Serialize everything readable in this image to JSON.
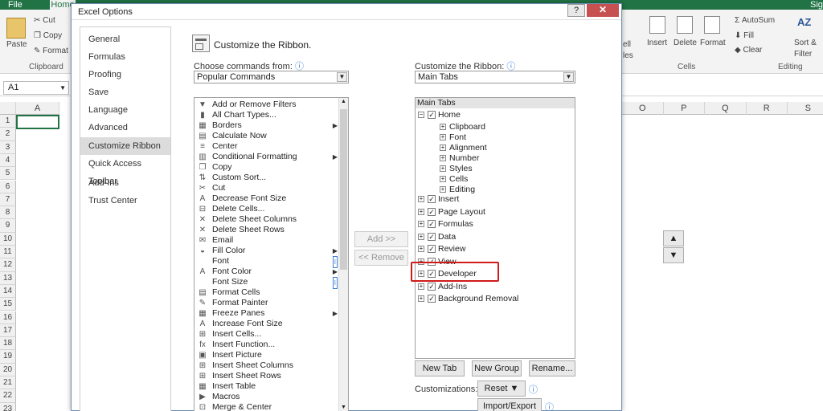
{
  "excel": {
    "tabs": {
      "file": "File",
      "home": "Home",
      "sign": "Sig"
    },
    "clipboard": {
      "paste": "Paste",
      "cut": "Cut",
      "copy": "Copy",
      "format": "Format",
      "group": "Clipboard"
    },
    "cells": {
      "insert": "Insert",
      "delete": "Delete",
      "format": "Format",
      "group": "Cells",
      "cell_partial": "ell",
      "les_partial": "les"
    },
    "editing": {
      "autosum": "AutoSum",
      "fill": "Fill",
      "clear": "Clear",
      "sort": "Sort &",
      "filter": "Filter",
      "group": "Editing"
    },
    "name_box": "A1",
    "columns_left": [
      "A"
    ],
    "columns_right": [
      "O",
      "P",
      "Q",
      "R",
      "S"
    ],
    "rows": [
      "1",
      "2",
      "3",
      "4",
      "5",
      "6",
      "7",
      "8",
      "9",
      "10",
      "11",
      "12",
      "13",
      "14",
      "15",
      "16",
      "17",
      "18",
      "19",
      "20",
      "21",
      "22",
      "23"
    ]
  },
  "dialog": {
    "title": "Excel Options",
    "help": "?",
    "close": "✕",
    "nav": [
      "General",
      "Formulas",
      "Proofing",
      "Save",
      "Language",
      "Advanced",
      "Customize Ribbon",
      "Quick Access Toolbar",
      "Add-Ins",
      "Trust Center"
    ],
    "selected_nav": "Customize Ribbon",
    "heading": "Customize the Ribbon.",
    "choose_label": "Choose commands from:",
    "choose_value": "Popular Commands",
    "customize_label": "Customize the Ribbon:",
    "customize_value": "Main Tabs",
    "commands": [
      {
        "icon": "filter-icon",
        "glyph": "▼",
        "label": "Add or Remove Filters",
        "arrow": ""
      },
      {
        "icon": "chart-icon",
        "glyph": "▮",
        "label": "All Chart Types...",
        "arrow": ""
      },
      {
        "icon": "borders-icon",
        "glyph": "▦",
        "label": "Borders",
        "arrow": "▶"
      },
      {
        "icon": "calculator-icon",
        "glyph": "▤",
        "label": "Calculate Now",
        "arrow": ""
      },
      {
        "icon": "center-icon",
        "glyph": "≡",
        "label": "Center",
        "arrow": ""
      },
      {
        "icon": "conditional-format-icon",
        "glyph": "▥",
        "label": "Conditional Formatting",
        "arrow": "▶"
      },
      {
        "icon": "copy-icon",
        "glyph": "❐",
        "label": "Copy",
        "arrow": ""
      },
      {
        "icon": "sort-icon",
        "glyph": "⇅",
        "label": "Custom Sort...",
        "arrow": ""
      },
      {
        "icon": "scissors-icon",
        "glyph": "✂",
        "label": "Cut",
        "arrow": ""
      },
      {
        "icon": "font-decrease-icon",
        "glyph": "A",
        "label": "Decrease Font Size",
        "arrow": ""
      },
      {
        "icon": "delete-cells-icon",
        "glyph": "⊟",
        "label": "Delete Cells...",
        "arrow": ""
      },
      {
        "icon": "delete-columns-icon",
        "glyph": "✕",
        "label": "Delete Sheet Columns",
        "arrow": ""
      },
      {
        "icon": "delete-rows-icon",
        "glyph": "✕",
        "label": "Delete Sheet Rows",
        "arrow": ""
      },
      {
        "icon": "email-icon",
        "glyph": "✉",
        "label": "Email",
        "arrow": ""
      },
      {
        "icon": "fill-color-icon",
        "glyph": "◒",
        "label": "Fill Color",
        "arrow": "▶"
      },
      {
        "icon": "font-icon",
        "glyph": "",
        "label": "Font",
        "arrow": "I"
      },
      {
        "icon": "font-color-icon",
        "glyph": "A",
        "label": "Font Color",
        "arrow": "▶"
      },
      {
        "icon": "font-size-icon",
        "glyph": "",
        "label": "Font Size",
        "arrow": "I"
      },
      {
        "icon": "format-cells-icon",
        "glyph": "▤",
        "label": "Format Cells",
        "arrow": ""
      },
      {
        "icon": "format-painter-icon",
        "glyph": "✎",
        "label": "Format Painter",
        "arrow": ""
      },
      {
        "icon": "freeze-panes-icon",
        "glyph": "▦",
        "label": "Freeze Panes",
        "arrow": "▶"
      },
      {
        "icon": "font-increase-icon",
        "glyph": "A",
        "label": "Increase Font Size",
        "arrow": ""
      },
      {
        "icon": "insert-cells-icon",
        "glyph": "⊞",
        "label": "Insert Cells...",
        "arrow": ""
      },
      {
        "icon": "function-icon",
        "glyph": "fx",
        "label": "Insert Function...",
        "arrow": ""
      },
      {
        "icon": "picture-icon",
        "glyph": "▣",
        "label": "Insert Picture",
        "arrow": ""
      },
      {
        "icon": "insert-columns-icon",
        "glyph": "⊞",
        "label": "Insert Sheet Columns",
        "arrow": ""
      },
      {
        "icon": "insert-rows-icon",
        "glyph": "⊞",
        "label": "Insert Sheet Rows",
        "arrow": ""
      },
      {
        "icon": "table-icon",
        "glyph": "▦",
        "label": "Insert Table",
        "arrow": ""
      },
      {
        "icon": "macros-icon",
        "glyph": "▶",
        "label": "Macros",
        "arrow": ""
      },
      {
        "icon": "merge-center-icon",
        "glyph": "⊡",
        "label": "Merge & Center",
        "arrow": ""
      }
    ],
    "add_button": "Add >>",
    "remove_button": "<< Remove",
    "tree_header": "Main Tabs",
    "tree": [
      {
        "label": "Home",
        "level": 0,
        "expander": "⊟",
        "checked": true,
        "bold": true
      },
      {
        "label": "Clipboard",
        "level": 1,
        "expander": "⊞",
        "checked": false
      },
      {
        "label": "Font",
        "level": 1,
        "expander": "⊞",
        "checked": false
      },
      {
        "label": "Alignment",
        "level": 1,
        "expander": "⊞",
        "checked": false
      },
      {
        "label": "Number",
        "level": 1,
        "expander": "⊞",
        "checked": false
      },
      {
        "label": "Styles",
        "level": 1,
        "expander": "⊞",
        "checked": false
      },
      {
        "label": "Cells",
        "level": 1,
        "expander": "⊞",
        "checked": false
      },
      {
        "label": "Editing",
        "level": 1,
        "expander": "⊞",
        "checked": false
      },
      {
        "label": "Insert",
        "level": 0,
        "expander": "⊞",
        "checked": true
      },
      {
        "label": "Page Layout",
        "level": 0,
        "expander": "⊞",
        "checked": true
      },
      {
        "label": "Formulas",
        "level": 0,
        "expander": "⊞",
        "checked": true
      },
      {
        "label": "Data",
        "level": 0,
        "expander": "⊞",
        "checked": true
      },
      {
        "label": "Review",
        "level": 0,
        "expander": "⊞",
        "checked": true
      },
      {
        "label": "View",
        "level": 0,
        "expander": "⊞",
        "checked": true
      },
      {
        "label": "Developer",
        "level": 0,
        "expander": "⊞",
        "checked": true
      },
      {
        "label": "Add-Ins",
        "level": 0,
        "expander": "⊞",
        "checked": true
      },
      {
        "label": "Background Removal",
        "level": 0,
        "expander": "⊞",
        "checked": true
      }
    ],
    "new_tab": "New Tab",
    "new_group": "New Group",
    "rename": "Rename...",
    "customizations_label": "Customizations:",
    "reset": "Reset ▼",
    "import_export": "Import/Export ▼",
    "move_up": "▲",
    "move_down": "▼",
    "accent_highlight": "#d11a1a"
  }
}
